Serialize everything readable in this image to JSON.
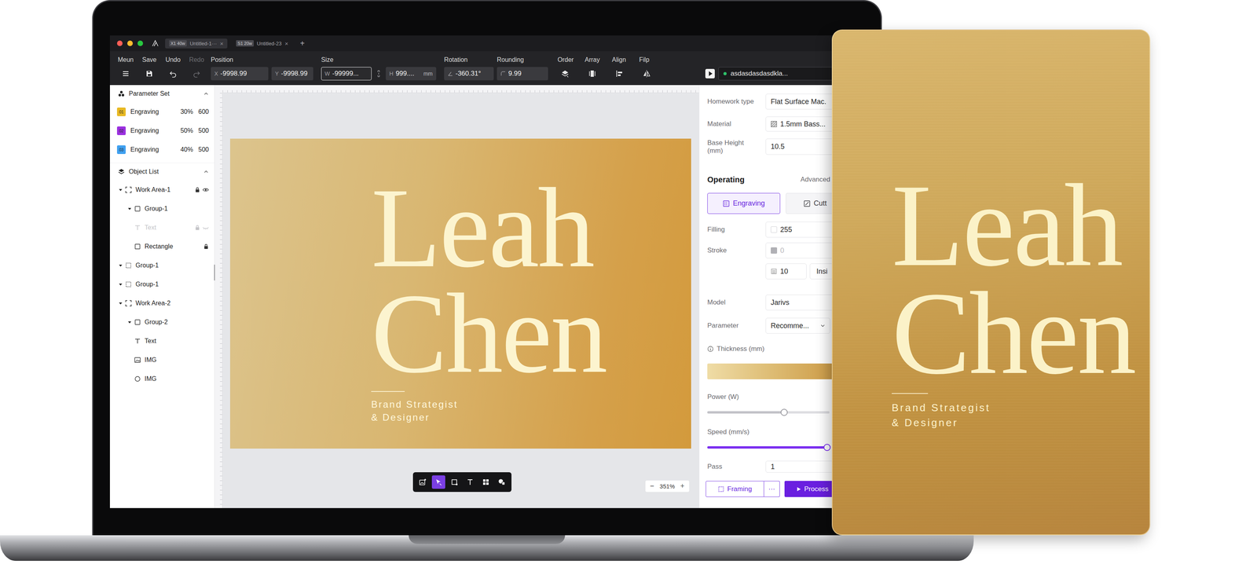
{
  "titlebar": {
    "tabs": [
      {
        "badge": "X1 40w",
        "label": "Untitled-1···",
        "close": "×",
        "selected": true
      },
      {
        "badge": "S1 20w",
        "label": "Untitled-23",
        "close": "×",
        "selected": false
      }
    ],
    "add": "+"
  },
  "toolbar": {
    "actions": [
      {
        "label": "Meun",
        "disabled": false
      },
      {
        "label": "Save",
        "disabled": false
      },
      {
        "label": "Undo",
        "disabled": false
      },
      {
        "label": "Redo",
        "disabled": true
      }
    ],
    "position": {
      "label": "Position",
      "fields": [
        {
          "prefix": "X",
          "value": "-9998.99"
        },
        {
          "prefix": "Y",
          "value": "-9998.99"
        }
      ]
    },
    "size": {
      "label": "Size",
      "width": {
        "prefix": "W",
        "value": "-99999...",
        "focused": true
      },
      "height": {
        "prefix": "H",
        "value": "999....",
        "unit": "mm",
        "focused": false
      }
    },
    "rotation": {
      "label": "Rotation",
      "value": "-360.31°"
    },
    "rounding": {
      "label": "Rounding",
      "value": "9.99"
    },
    "arrange": [
      {
        "label": "Order"
      },
      {
        "label": "Array"
      },
      {
        "label": "Align"
      },
      {
        "label": "Filp"
      }
    ],
    "device": {
      "name": "asdasdasdasdkla...",
      "connected": true
    }
  },
  "parameterSet": {
    "title": "Parameter Set",
    "expanded": true,
    "items": [
      {
        "badge": "01",
        "name": "Engraving",
        "power": "30%",
        "speed": "600",
        "color": "#e8b923"
      },
      {
        "badge": "02",
        "name": "Engraving",
        "power": "50%",
        "speed": "500",
        "color": "#9b30e0"
      },
      {
        "badge": "03",
        "name": "Engraving",
        "power": "40%",
        "speed": "500",
        "color": "#3fa0f0"
      }
    ]
  },
  "objectList": {
    "title": "Object List",
    "expanded": true,
    "items": [
      {
        "label": "Work Area-1",
        "depth": 0,
        "kind": "area",
        "expanded": true,
        "locked": true,
        "eye": "open"
      },
      {
        "label": "Group-1",
        "depth": 1,
        "kind": "group",
        "expanded": true,
        "locked": false,
        "eye": "none"
      },
      {
        "label": "Text",
        "depth": 2,
        "kind": "text",
        "expanded": null,
        "locked": true,
        "eye": "closed"
      },
      {
        "label": "Rectangle",
        "depth": 2,
        "kind": "rect",
        "expanded": null,
        "locked": true,
        "eye": "none"
      },
      {
        "label": "Group-1",
        "depth": 0,
        "kind": "selection",
        "expanded": true,
        "locked": false,
        "eye": "none"
      },
      {
        "label": "Group-1",
        "depth": 0,
        "kind": "selection",
        "expanded": true,
        "locked": false,
        "eye": "none"
      },
      {
        "label": "Work Area-2",
        "depth": 0,
        "kind": "area",
        "expanded": true,
        "locked": false,
        "eye": "none"
      },
      {
        "label": "Group-2",
        "depth": 1,
        "kind": "group",
        "expanded": true,
        "locked": false,
        "eye": "none"
      },
      {
        "label": "Text",
        "depth": 2,
        "kind": "text",
        "expanded": null,
        "locked": false,
        "eye": "none"
      },
      {
        "label": "IMG",
        "depth": 2,
        "kind": "image",
        "expanded": null,
        "locked": false,
        "eye": "none"
      },
      {
        "label": "IMG",
        "depth": 2,
        "kind": "circle",
        "expanded": null,
        "locked": false,
        "eye": "none"
      }
    ]
  },
  "canvas": {
    "design": {
      "name": [
        "Leah",
        "Chen"
      ],
      "subtitle": [
        "Brand Strategist",
        "& Designer"
      ]
    },
    "tools": [
      {
        "selected": false
      },
      {
        "selected": true
      },
      {
        "selected": false
      },
      {
        "selected": false
      },
      {
        "selected": false
      },
      {
        "selected": false
      }
    ],
    "zoom": {
      "out": "−",
      "value": "351%",
      "in": "+"
    }
  },
  "rightPanel": {
    "fields": [
      {
        "label": "Homework type",
        "value": "Flat Surface Mac.",
        "kind": "plain"
      },
      {
        "label": "Material",
        "value": "1.5mm Bass...",
        "kind": "swatch"
      },
      {
        "label": "Base Height (mm)",
        "value": "10.5",
        "kind": "plain"
      }
    ],
    "operating": {
      "title": "Operating",
      "advanced": "Advanced",
      "modes": [
        {
          "label": "Engraving",
          "selected": true
        },
        {
          "label": "Cutt",
          "selected": false
        }
      ]
    },
    "filling": {
      "label": "Filling",
      "value": "255"
    },
    "stroke": {
      "label": "Stroke",
      "value": "0",
      "disabled": true,
      "width": "10",
      "align": "Insi"
    },
    "model": {
      "label": "Model",
      "value": "Jarivs"
    },
    "parameter": {
      "label": "Parameter",
      "value": "Recomme..."
    },
    "thickness": {
      "label": "Thickness (mm)"
    },
    "power": {
      "label": "Power (W)",
      "level": 0.63
    },
    "speed": {
      "label": "Speed (mm/s)",
      "level": 0.98
    },
    "pass": {
      "label": "Pass",
      "value": "1"
    },
    "actions": {
      "framing": "Framing",
      "more": "···",
      "process": "Process"
    }
  },
  "card": {
    "name": [
      "Leah",
      "Chen"
    ],
    "subtitle": [
      "Brand Strategist",
      "& Designer"
    ]
  }
}
